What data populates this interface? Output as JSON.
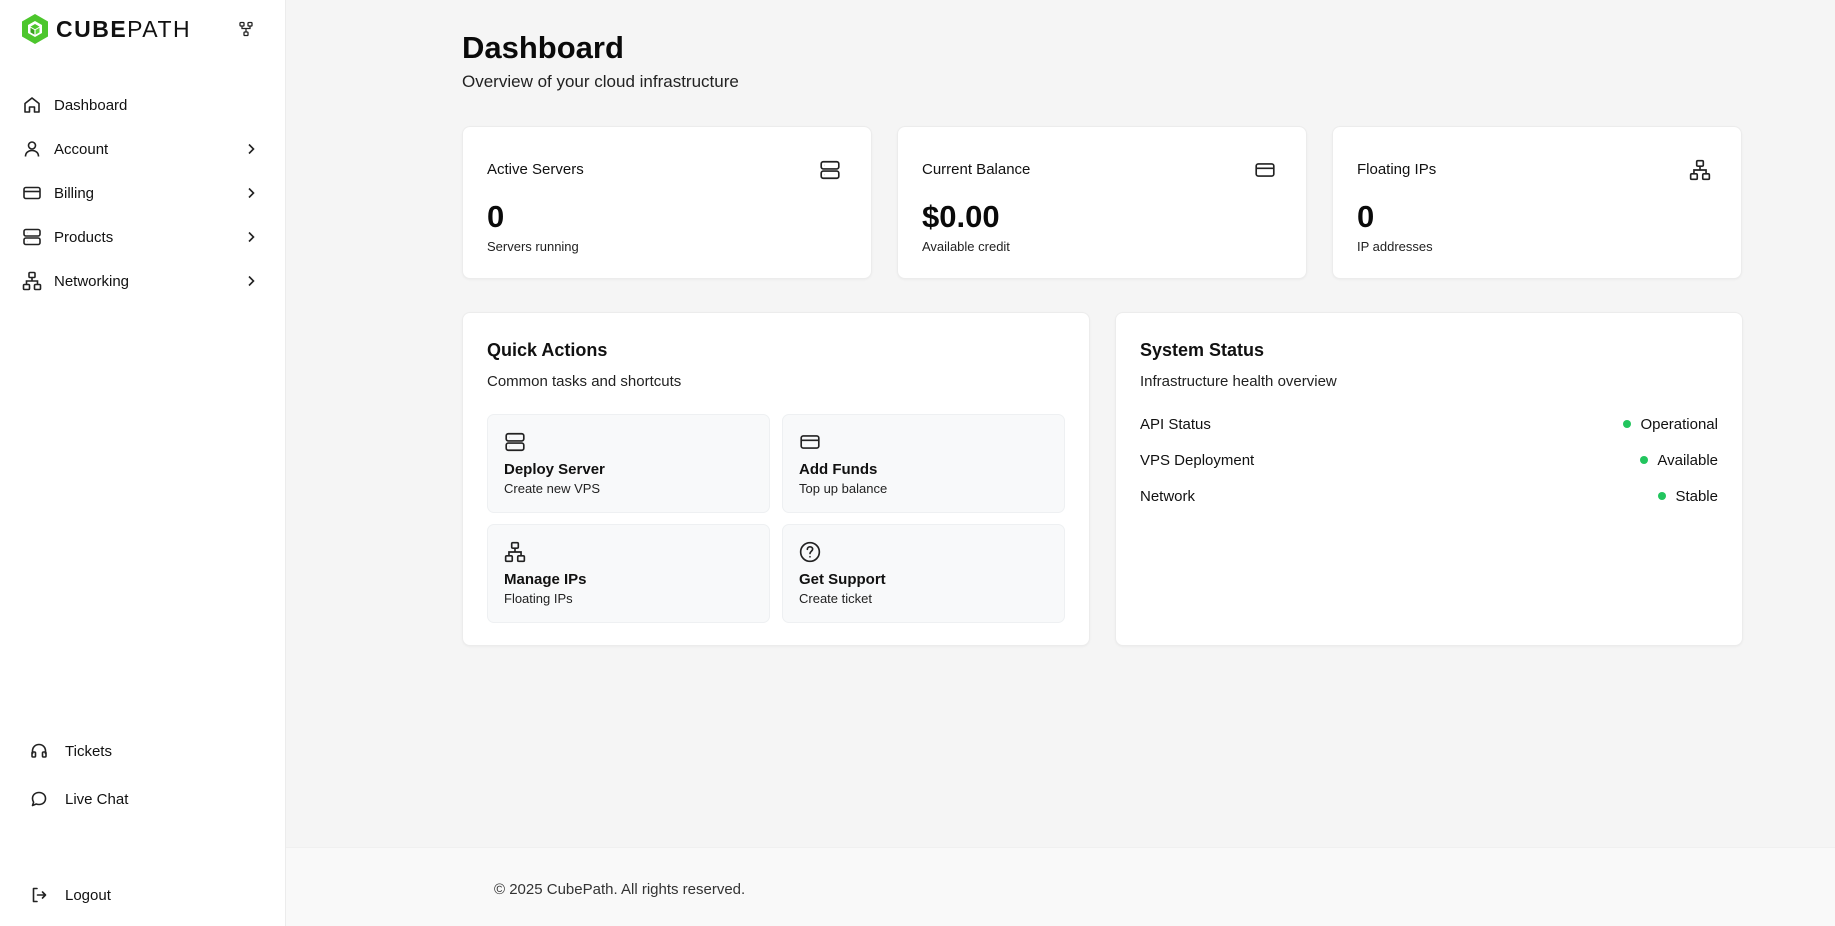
{
  "brand": {
    "name_bold": "CUBE",
    "name_light": "PATH",
    "accent": "#4cc62c"
  },
  "sidebar": {
    "items": [
      {
        "label": "Dashboard",
        "icon": "home-icon"
      },
      {
        "label": "Account",
        "icon": "user-icon"
      },
      {
        "label": "Billing",
        "icon": "credit-card-icon"
      },
      {
        "label": "Products",
        "icon": "server-icon"
      },
      {
        "label": "Networking",
        "icon": "network-icon"
      }
    ],
    "bottom": [
      {
        "label": "Tickets",
        "icon": "headphones-icon"
      },
      {
        "label": "Live Chat",
        "icon": "chat-icon"
      },
      {
        "label": "Logout",
        "icon": "logout-icon"
      }
    ]
  },
  "header": {
    "title": "Dashboard",
    "subtitle": "Overview of your cloud infrastructure"
  },
  "stats": [
    {
      "title": "Active Servers",
      "value": "0",
      "sub": "Servers running",
      "icon": "server-icon"
    },
    {
      "title": "Current Balance",
      "value": "$0.00",
      "sub": "Available credit",
      "icon": "credit-card-icon"
    },
    {
      "title": "Floating IPs",
      "value": "0",
      "sub": "IP addresses",
      "icon": "network-icon"
    }
  ],
  "quick_actions": {
    "title": "Quick Actions",
    "subtitle": "Common tasks and shortcuts",
    "items": [
      {
        "title": "Deploy Server",
        "sub": "Create new VPS",
        "icon": "server-icon"
      },
      {
        "title": "Add Funds",
        "sub": "Top up balance",
        "icon": "credit-card-icon"
      },
      {
        "title": "Manage IPs",
        "sub": "Floating IPs",
        "icon": "network-icon"
      },
      {
        "title": "Get Support",
        "sub": "Create ticket",
        "icon": "help-circle-icon"
      }
    ]
  },
  "system_status": {
    "title": "System Status",
    "subtitle": "Infrastructure health overview",
    "status_color": "#22c55e",
    "items": [
      {
        "label": "API Status",
        "value": "Operational"
      },
      {
        "label": "VPS Deployment",
        "value": "Available"
      },
      {
        "label": "Network",
        "value": "Stable"
      }
    ]
  },
  "footer": {
    "text": "© 2025 CubePath. All rights reserved."
  }
}
